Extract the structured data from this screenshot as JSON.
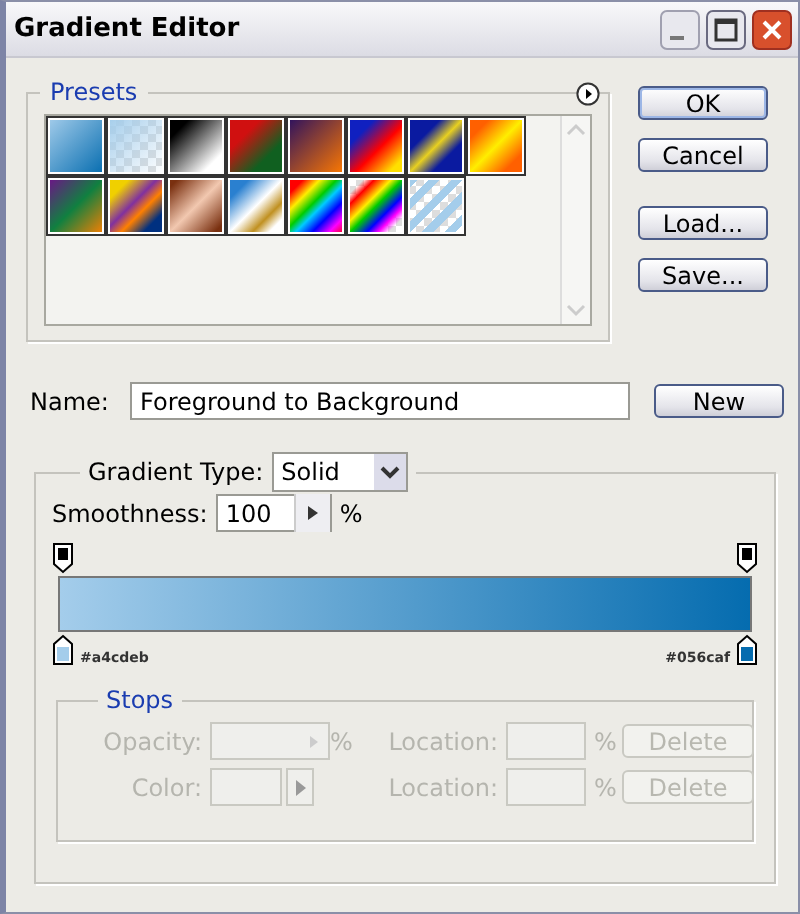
{
  "window": {
    "title": "Gradient Editor"
  },
  "presets": {
    "label": "Presets"
  },
  "buttons": [
    {
      "label": "OK",
      "default": true
    },
    {
      "label": "Cancel",
      "default": false
    },
    {
      "label": "Load...",
      "default": false
    },
    {
      "label": "Save...",
      "default": false
    }
  ],
  "name_field": {
    "label": "Name:",
    "value": "Foreground to Background",
    "button": "New"
  },
  "gradient": {
    "type_label": "Gradient Type:",
    "type_value": "Solid",
    "smoothness_label": "Smoothness:",
    "smoothness_value": "100",
    "smoothness_unit": "%",
    "color_stops": [
      {
        "label": "#a4cdeb",
        "color": "#a4cdeb"
      },
      {
        "label": "#056caf",
        "color": "#056caf"
      }
    ]
  },
  "stops": {
    "label": "Stops",
    "disabled": true,
    "rows": [
      {
        "kind": "opacity",
        "label": "Opacity:",
        "unit": "%",
        "location_label": "Location:",
        "location_unit": "%",
        "button": "Delete"
      },
      {
        "kind": "color",
        "label": "Color:",
        "location_label": "Location:",
        "location_unit": "%",
        "button": "Delete"
      }
    ]
  }
}
